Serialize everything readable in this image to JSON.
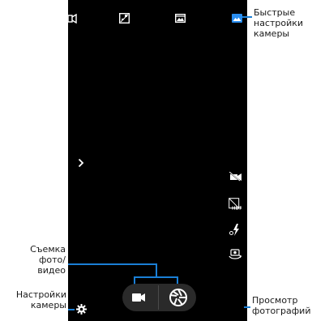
{
  "labels": {
    "quick_settings": "Быстрые\nнастройки\nкамеры",
    "capture": "Съемка\nфото/видео",
    "settings": "Настройки\nкамеры",
    "gallery": "Просмотр\nфотографий"
  },
  "icons": {
    "top": [
      "panorama-mode-icon",
      "exposure-icon",
      "scene-mode-icon",
      "quick-settings-picture-icon"
    ],
    "side": [
      "sidebar-expand-chevron-icon",
      "video-off-icon",
      "hdr-icon",
      "flash-auto-icon",
      "switch-camera-icon"
    ],
    "bottom": [
      "video-record-button",
      "shutter-button",
      "settings-gear-icon"
    ]
  },
  "colors": {
    "accent": "#1a7fd6",
    "screen": "#000000",
    "icon": "#ffffff"
  }
}
